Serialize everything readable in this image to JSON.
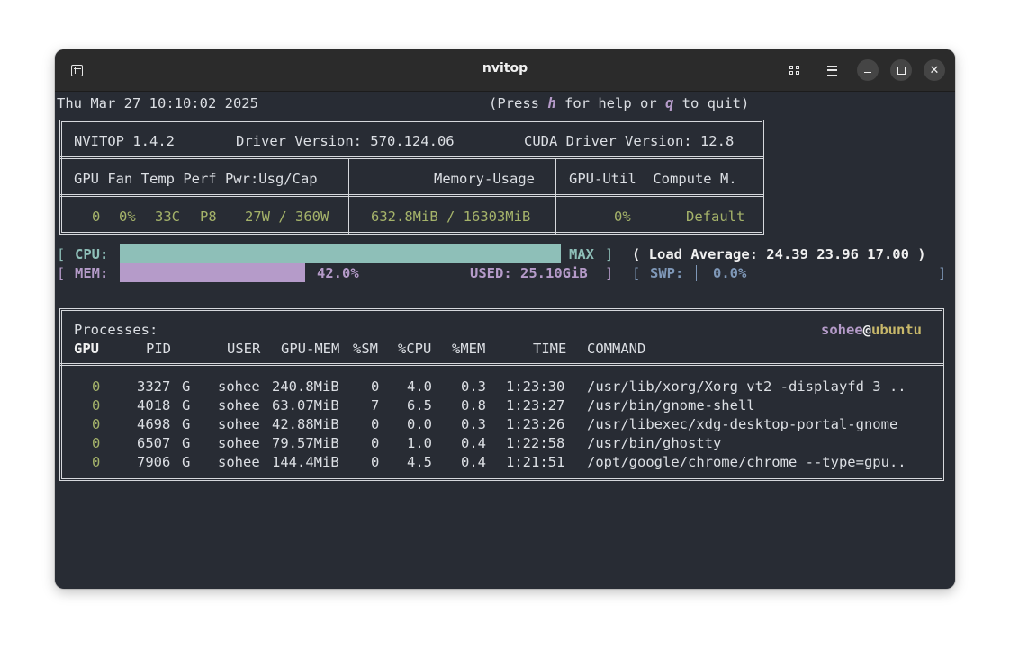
{
  "window": {
    "title": "nvitop"
  },
  "titlebar": {
    "new_tab_icon": "new-tab-icon",
    "grid_icon": "grid-view-icon",
    "menu_icon": "hamburger-menu-icon",
    "minimize_icon": "minimize-icon",
    "maximize_icon": "maximize-icon",
    "close_glyph": "✕"
  },
  "header": {
    "datetime": "Thu Mar 27 10:10:02 2025",
    "help_open": "(Press ",
    "help_key": "h",
    "help_mid": " for help or ",
    "quit_key": "q",
    "help_close": " to quit)"
  },
  "gpu_panel": {
    "nvitop_version": "NVITOP 1.4.2",
    "driver_version": "Driver Version: 570.124.06",
    "cuda_version": "CUDA Driver Version: 12.8",
    "col_left": "GPU Fan Temp Perf Pwr:Usg/Cap",
    "col_mid": "Memory-Usage",
    "col_right": "GPU-Util  Compute M.",
    "gpu_index": "0",
    "fan": "0%",
    "temp": "33C",
    "perf": "P8",
    "power": "27W / 360W",
    "memory": "632.8MiB / 16303MiB",
    "util": "0%",
    "compute_mode": "Default"
  },
  "host": {
    "bracket_open": "[",
    "bracket_close": "]",
    "cpu_label": "CPU:",
    "cpu_value": "MAX",
    "cpu_percent": 98.0,
    "load_average": "( Load Average: 24.39 23.96 17.00 )",
    "mem_label": "MEM:",
    "mem_percent_text": "42.0%",
    "mem_percent": 42.0,
    "mem_used": "USED: 25.10GiB",
    "swp_label": "SWP:",
    "swp_percent_text": "0.0%"
  },
  "processes": {
    "title": "Processes:",
    "user": "sohee",
    "at": "@",
    "host": "ubuntu",
    "headers": [
      "GPU",
      "PID",
      "USER",
      "GPU-MEM",
      "%SM",
      "%CPU",
      "%MEM",
      "TIME",
      "COMMAND"
    ],
    "rows": [
      {
        "gpu": "0",
        "pid": "3327",
        "type": "G",
        "user": "sohee",
        "gpu_mem": "240.8MiB",
        "sm": "0",
        "cpu": "4.0",
        "mem": "0.3",
        "time": "1:23:30",
        "command": "/usr/lib/xorg/Xorg vt2 -displayfd 3 .."
      },
      {
        "gpu": "0",
        "pid": "4018",
        "type": "G",
        "user": "sohee",
        "gpu_mem": "63.07MiB",
        "sm": "7",
        "cpu": "6.5",
        "mem": "0.8",
        "time": "1:23:27",
        "command": "/usr/bin/gnome-shell"
      },
      {
        "gpu": "0",
        "pid": "4698",
        "type": "G",
        "user": "sohee",
        "gpu_mem": "42.88MiB",
        "sm": "0",
        "cpu": "0.0",
        "mem": "0.3",
        "time": "1:23:26",
        "command": "/usr/libexec/xdg-desktop-portal-gnome"
      },
      {
        "gpu": "0",
        "pid": "6507",
        "type": "G",
        "user": "sohee",
        "gpu_mem": "79.57MiB",
        "sm": "0",
        "cpu": "1.0",
        "mem": "0.4",
        "time": "1:22:58",
        "command": "/usr/bin/ghostty"
      },
      {
        "gpu": "0",
        "pid": "7906",
        "type": "G",
        "user": "sohee",
        "gpu_mem": "144.4MiB",
        "sm": "0",
        "cpu": "4.5",
        "mem": "0.4",
        "time": "1:21:51",
        "command": "/opt/google/chrome/chrome --type=gpu.."
      }
    ]
  },
  "colors": {
    "background": "#282c34",
    "cpu_bar": "#8ebfb8",
    "mem_bar": "#b59bc9",
    "gpu_green": "#a5b36a",
    "swp_blue": "#7f98b8"
  }
}
